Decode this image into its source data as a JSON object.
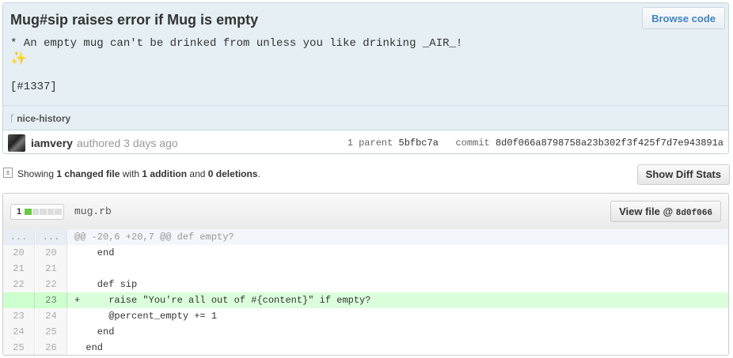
{
  "commit": {
    "title": "Mug#sip raises error if Mug is empty",
    "browse_label": "Browse code",
    "description": "* An empty mug can't be drinked from unless you like drinking _AIR_!",
    "sparkle": "✨",
    "issue_ref": "[#1337]",
    "branch": "nice-history",
    "author": "iamvery",
    "authored_text": "authored 3 days ago",
    "parent_label": "1 parent",
    "parent_sha": "5bfbc7a",
    "commit_label": "commit",
    "commit_sha": "8d0f066a8798758a23b302f3f425f7d7e943891a"
  },
  "toc": {
    "prefix": "Showing ",
    "changed": "1 changed file",
    "with": " with ",
    "additions": "1 addition",
    "and": " and ",
    "deletions": "0 deletions",
    "suffix": ".",
    "diff_stats_label": "Show Diff Stats"
  },
  "file": {
    "stat_count": "1",
    "stat_bar": [
      "add",
      "none",
      "none",
      "none",
      "none"
    ],
    "name": "mug.rb",
    "view_label": "View file @ ",
    "view_sha": "8d0f066",
    "lines": [
      {
        "type": "hunk",
        "old": "...",
        "new": "...",
        "text": "@@ -20,6 +20,7 @@ def empty?"
      },
      {
        "type": "ctx",
        "old": "20",
        "new": "20",
        "text": "    end"
      },
      {
        "type": "ctx",
        "old": "21",
        "new": "21",
        "text": ""
      },
      {
        "type": "ctx",
        "old": "22",
        "new": "22",
        "text": "    def sip"
      },
      {
        "type": "add",
        "old": "",
        "new": "23",
        "text": "+     raise \"You're all out of #{content}\" if empty?"
      },
      {
        "type": "ctx",
        "old": "23",
        "new": "24",
        "text": "      @percent_empty += 1"
      },
      {
        "type": "ctx",
        "old": "24",
        "new": "25",
        "text": "    end"
      },
      {
        "type": "ctx",
        "old": "25",
        "new": "26",
        "text": "  end"
      }
    ]
  }
}
